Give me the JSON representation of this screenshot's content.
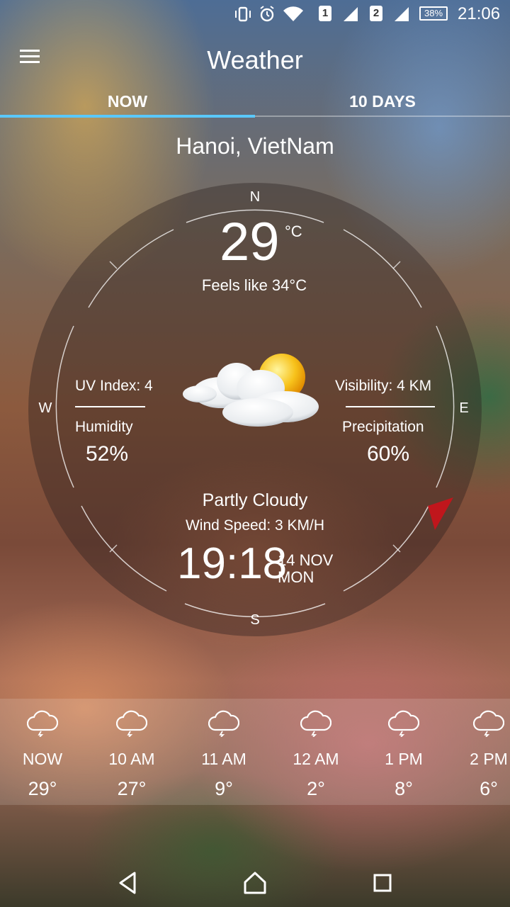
{
  "status_bar": {
    "sim1": "1",
    "sim2": "2",
    "battery": "38%",
    "time": "21:06",
    "icons": [
      "vibrate-icon",
      "alarm-icon",
      "wifi-icon",
      "signal-icon",
      "battery-icon"
    ]
  },
  "app_bar": {
    "title": "Weather",
    "menu_icon": "hamburger-menu-icon"
  },
  "tabs": [
    {
      "label": "NOW",
      "selected": true
    },
    {
      "label": "10 DAYS",
      "selected": false
    }
  ],
  "location": "Hanoi, VietNam",
  "compass": {
    "north": "N",
    "south": "S",
    "west": "W",
    "east": "E"
  },
  "current": {
    "temperature": "29",
    "unit": "°C",
    "feels_like": "Feels like 34°C",
    "uv_index": "UV Index: 4",
    "humidity_label": "Humidity",
    "humidity": "52%",
    "visibility": "Visibility: 4 KM",
    "precipitation_label": "Precipitation",
    "precipitation": "60%",
    "condition": "Partly Cloudy",
    "condition_icon": "partly-cloudy-icon",
    "wind_speed": "Wind Speed: 3 KM/H",
    "time": "19:18",
    "date": "14 NOV",
    "weekday": "MON"
  },
  "hourly": [
    {
      "label": "NOW",
      "temp": "29°",
      "icon": "rain-cloud-icon"
    },
    {
      "label": "10 AM",
      "temp": "27°",
      "icon": "rain-cloud-icon"
    },
    {
      "label": "11 AM",
      "temp": "9°",
      "icon": "rain-cloud-icon"
    },
    {
      "label": "12 AM",
      "temp": "2°",
      "icon": "rain-cloud-icon"
    },
    {
      "label": "1 PM",
      "temp": "8°",
      "icon": "rain-cloud-icon"
    },
    {
      "label": "2 PM",
      "temp": "6°",
      "icon": "rain-cloud-icon"
    }
  ],
  "nav_bar": [
    "back-icon",
    "home-icon",
    "recents-icon"
  ],
  "colors": {
    "tab_indicator": "#5ac8fa",
    "wind_pointer": "#c0161c"
  }
}
